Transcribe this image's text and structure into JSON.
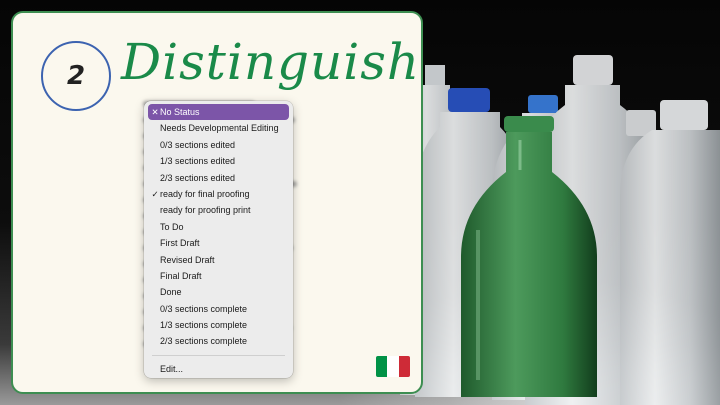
{
  "card": {
    "step_number": "2",
    "title": "Distinguish"
  },
  "status_menu": {
    "items": [
      {
        "label": "No Status",
        "mark": "✕",
        "highlighted": true
      },
      {
        "label": "Needs Developmental Editing",
        "mark": ""
      },
      {
        "label": "0/3 sections edited",
        "mark": ""
      },
      {
        "label": "1/3 sections edited",
        "mark": ""
      },
      {
        "label": "2/3 sections edited",
        "mark": ""
      },
      {
        "label": "ready for final proofing",
        "mark": "✓"
      },
      {
        "label": "ready for proofing print",
        "mark": ""
      },
      {
        "label": "To Do",
        "mark": ""
      },
      {
        "label": "First Draft",
        "mark": ""
      },
      {
        "label": "Revised Draft",
        "mark": ""
      },
      {
        "label": "Final Draft",
        "mark": ""
      },
      {
        "label": "Done",
        "mark": ""
      },
      {
        "label": "0/3 sections complete",
        "mark": ""
      },
      {
        "label": "1/3 sections complete",
        "mark": ""
      },
      {
        "label": "2/3 sections complete",
        "mark": ""
      }
    ],
    "edit_label": "Edit...",
    "highlight_color": "#7c55a8"
  },
  "flag": {
    "icon": "italy-flag-icon",
    "colors": [
      "#009246",
      "#ffffff",
      "#ce2b37"
    ]
  },
  "colors": {
    "card_border": "#3d8e51",
    "title": "#1a8a49",
    "step_circle": "#3c63b0"
  }
}
